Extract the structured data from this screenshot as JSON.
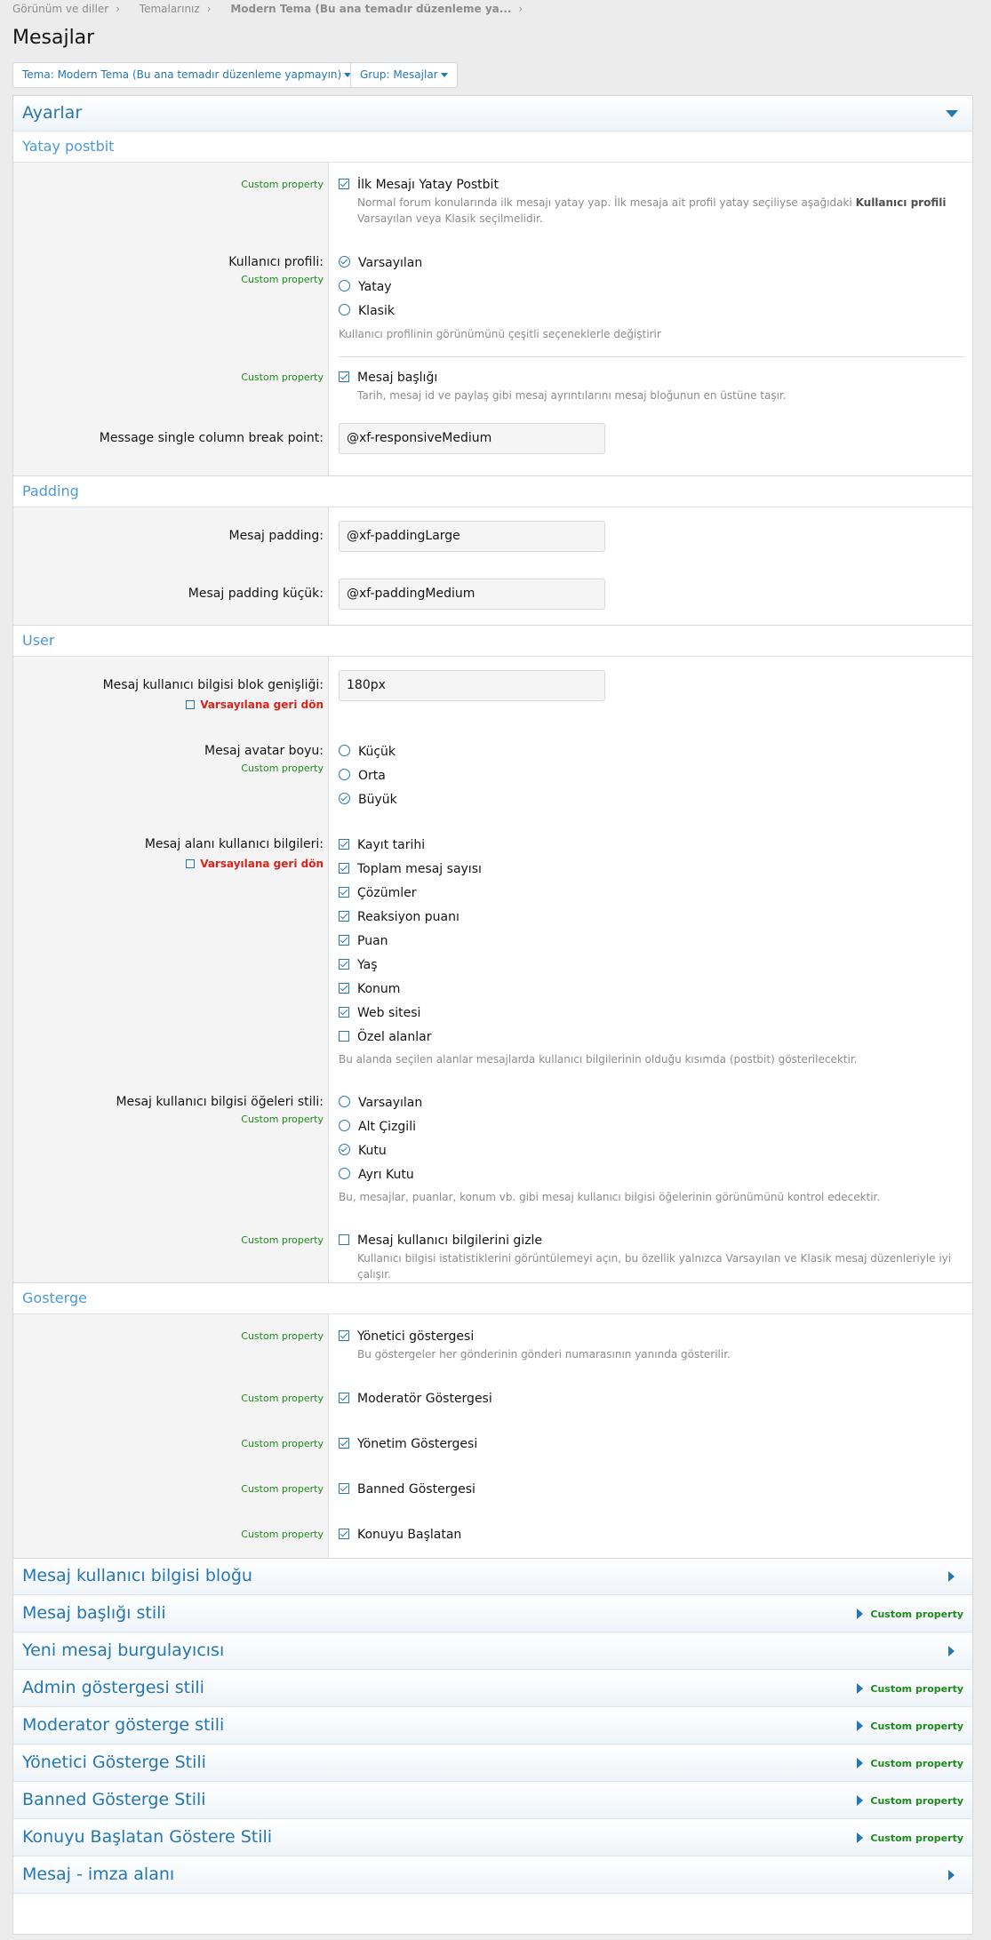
{
  "breadcrumb": [
    "Görünüm ve diller",
    "Temalarınız",
    "Modern Tema (Bu ana temadır düzenleme ya..."
  ],
  "page_title": "Mesajlar",
  "filters": {
    "theme": "Tema: Modern Tema (Bu ana temadır düzenleme yapmayın)",
    "group": "Grup: Mesajlar"
  },
  "ayarlar": "Ayarlar",
  "custom_property": "Custom property",
  "revert": "Varsayılana geri dön",
  "sections": {
    "yatay": "Yatay postbit",
    "padding": "Padding",
    "user": "User",
    "gosterge": "Gosterge"
  },
  "yatay": {
    "first_post": {
      "label": "İlk Mesajı Yatay Postbit",
      "checked": true,
      "hint_pre": "Normal forum konularında ilk mesajı yatay yap. İlk mesaja ait profil yatay seçiliyse aşağıdaki",
      "hint_bold": "Kullanıcı profili",
      "hint_post": "Varsayılan veya Klasik seçilmelidir."
    },
    "profile": {
      "label": "Kullanıcı profili:",
      "options": [
        "Varsayılan",
        "Yatay",
        "Klasik"
      ],
      "selected": "Varsayılan",
      "hint": "Kullanıcı profilinin görünümünü çeşitli seçeneklerle değiştirir"
    },
    "header": {
      "label": "Mesaj başlığı",
      "checked": true,
      "hint": "Tarih, mesaj id ve paylaş gibi mesaj ayrıntılarını mesaj bloğunun en üstüne taşır."
    },
    "breakpoint": {
      "label": "Message single column break point:",
      "value": "@xf-responsiveMedium"
    }
  },
  "padding": {
    "large": {
      "label": "Mesaj padding:",
      "value": "@xf-paddingLarge"
    },
    "small": {
      "label": "Mesaj padding küçük:",
      "value": "@xf-paddingMedium"
    }
  },
  "user": {
    "block_width": {
      "label": "Mesaj kullanıcı bilgisi blok genişliği:",
      "value": "180px"
    },
    "avatar": {
      "label": "Mesaj avatar boyu:",
      "options": [
        "Küçük",
        "Orta",
        "Büyük"
      ],
      "selected": "Büyük"
    },
    "fields": {
      "label": "Mesaj alanı kullanıcı bilgileri:",
      "options": [
        "Kayıt tarihi",
        "Toplam mesaj sayısı",
        "Çözümler",
        "Reaksiyon puanı",
        "Puan",
        "Yaş",
        "Konum",
        "Web sitesi",
        "Özel alanlar"
      ],
      "checked": [
        true,
        true,
        true,
        true,
        true,
        true,
        true,
        true,
        false
      ],
      "hint": "Bu alanda seçilen alanlar mesajlarda kullanıcı bilgilerinin olduğu kısımda (postbit) gösterilecektir."
    },
    "style": {
      "label": "Mesaj kullanıcı bilgisi öğeleri stili:",
      "options": [
        "Varsayılan",
        "Alt Çizgili",
        "Kutu",
        "Ayrı Kutu"
      ],
      "selected": "Kutu",
      "hint": "Bu, mesajlar, puanlar, konum vb. gibi mesaj kullanıcı bilgisi öğelerinin görünümünü kontrol edecektir."
    },
    "hide": {
      "label": "Mesaj kullanıcı bilgilerini gizle",
      "checked": false,
      "hint": "Kullanıcı bilgisi istatistiklerini görüntülemeyi açın, bu özellik yalnızca Varsayılan ve Klasik mesaj düzenleriyle iyi çalışır."
    }
  },
  "gosterge": {
    "admin": {
      "label": "Yönetici göstergesi",
      "checked": true,
      "hint": "Bu göstergeler her gönderinin gönderi numarasının yanında gösterilir."
    },
    "moderator": {
      "label": "Moderatör Göstergesi",
      "checked": true
    },
    "staff": {
      "label": "Yönetim Göstergesi",
      "checked": true
    },
    "banned": {
      "label": "Banned Göstergesi",
      "checked": true
    },
    "starter": {
      "label": "Konuyu Başlatan",
      "checked": true
    }
  },
  "collapsed_groups": [
    {
      "title": "Mesaj kullanıcı bilgisi bloğu",
      "custom": false
    },
    {
      "title": "Mesaj başlığı stili",
      "custom": true
    },
    {
      "title": "Yeni mesaj burgulayıcısı",
      "custom": false
    },
    {
      "title": "Admin göstergesi stili",
      "custom": true
    },
    {
      "title": "Moderator gösterge stili",
      "custom": true
    },
    {
      "title": "Yönetici Gösterge Stili",
      "custom": true
    },
    {
      "title": "Banned Gösterge Stili",
      "custom": true
    },
    {
      "title": "Konuyu Başlatan Göstere Stili",
      "custom": true
    },
    {
      "title": "Mesaj - imza alanı",
      "custom": false
    }
  ]
}
